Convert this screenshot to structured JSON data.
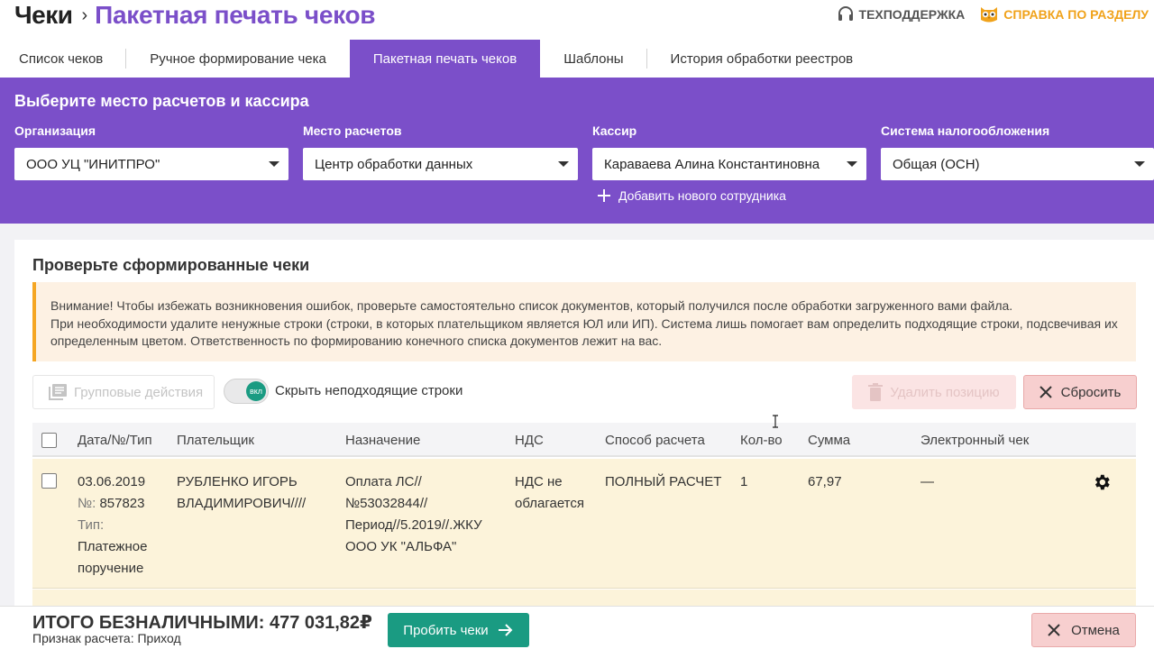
{
  "header": {
    "root": "Чеки",
    "separator": "›",
    "current": "Пакетная печать чеков",
    "support_label": "ТЕХПОДДЕРЖКА",
    "help_label": "СПРАВКА ПО РАЗДЕЛУ"
  },
  "tabs": [
    {
      "label": "Список чеков",
      "active": false
    },
    {
      "label": "Ручное формирование чека",
      "active": false
    },
    {
      "label": "Пакетная печать чеков",
      "active": true
    },
    {
      "label": "Шаблоны",
      "active": false
    },
    {
      "label": "История обработки реестров",
      "active": false
    }
  ],
  "selection": {
    "title": "Выберите место расчетов и кассира",
    "organization": {
      "label": "Организация",
      "value": "ООО УЦ \"ИНИТПРО\""
    },
    "place": {
      "label": "Место расчетов",
      "value": "Центр обработки данных"
    },
    "cashier": {
      "label": "Кассир",
      "value": "Караваева Алина Константиновна"
    },
    "tax": {
      "label": "Система налогообложения",
      "value": "Общая (ОСН)"
    },
    "add_employee": "Добавить нового сотрудника"
  },
  "review": {
    "title": "Проверьте сформированные чеки",
    "warning_line1": "Внимание! Чтобы избежать возникновения ошибок, проверьте самостоятельно список документов, который получился после обработки загруженного вами файла.",
    "warning_line2": "При необходимости удалите ненужные строки (строки, в которых плательщиком является ЮЛ или ИП). Система лишь помогает вам определить подходящие строки, подсвечивая их определенным цветом. Ответственность по формированию конечного списка документов лежит на вас."
  },
  "toolbar": {
    "group_actions": "Групповые действия",
    "toggle_badge": "вкл",
    "toggle_label": "Скрыть неподходящие строки",
    "delete_label": "Удалить позицию",
    "reset_label": "Сбросить"
  },
  "table": {
    "columns": {
      "date": "Дата/№/Тип",
      "payer": "Плательщик",
      "purpose": "Назначение",
      "vat": "НДС",
      "method": "Способ расчета",
      "qty": "Кол-во",
      "sum": "Сумма",
      "ereceipt": "Электронный чек"
    },
    "rows": [
      {
        "date": "03.06.2019",
        "num_label": "№:",
        "num": "857823",
        "type_label": "Тип:",
        "type_line1": "Платежное",
        "type_line2": "поручение",
        "payer_line1": "РУБЛЕНКО ИГОРЬ",
        "payer_line2": "ВЛАДИМИРОВИЧ////",
        "purpose_line1": "Оплата ЛС//",
        "purpose_line2": "№53032844//",
        "purpose_line3": "Период//5.2019//.ЖКУ",
        "purpose_line4": "ООО УК \"АЛЬФА\"",
        "vat_line1": "НДС не",
        "vat_line2": "облагается",
        "method": "ПОЛНЫЙ РАСЧЕТ",
        "qty": "1",
        "sum": "67,97",
        "ereceipt": "—"
      }
    ]
  },
  "footer": {
    "total": "ИТОГО БЕЗНАЛИЧНЫМИ: 477 031,82₽",
    "sign": "Признак расчета: Приход",
    "pay_label": "Пробить чеки",
    "cancel_label": "Отмена"
  },
  "colors": {
    "brand_purple": "#7b4fc9",
    "accent_green": "#1a9b82",
    "warning_orange": "#f5a623",
    "row_highlight": "#fcf3da"
  }
}
